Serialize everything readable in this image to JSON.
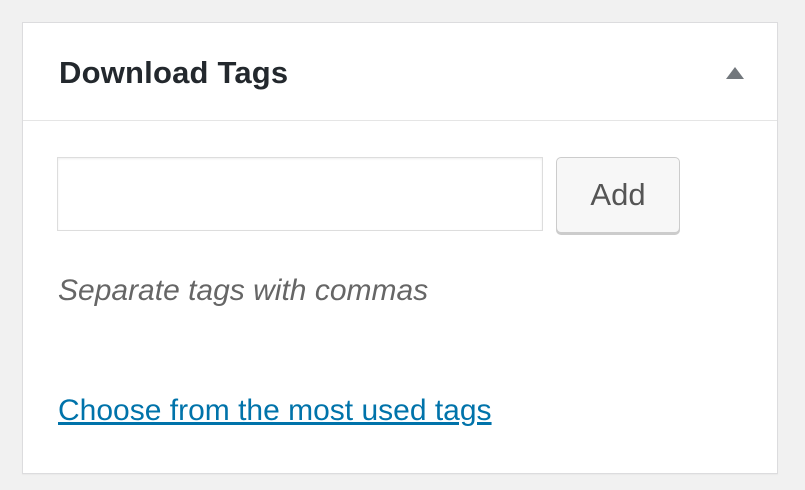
{
  "metabox": {
    "title": "Download Tags",
    "toggle_icon": "triangle-up-icon",
    "input": {
      "value": "",
      "placeholder": ""
    },
    "add_label": "Add",
    "help_text": "Separate tags with commas",
    "most_used_link": "Choose from the most used tags"
  },
  "colors": {
    "background": "#f1f1f1",
    "panel": "#ffffff",
    "link": "#0073aa",
    "title": "#23282d",
    "help_text": "#666666"
  }
}
